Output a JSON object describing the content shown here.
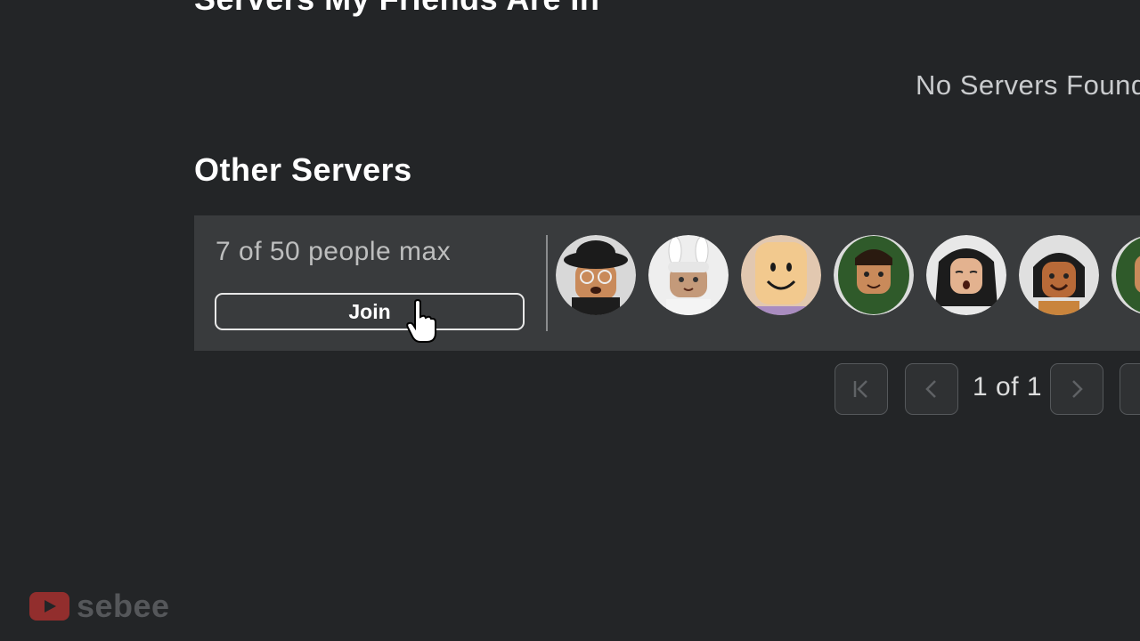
{
  "sections": {
    "friends_title": "Servers My Friends Are In",
    "no_servers": "No Servers Found",
    "other_title": "Other Servers"
  },
  "server": {
    "capacity": "7 of 50 people max",
    "join_label": "Join",
    "players": [
      {
        "name": "player-avatar-1",
        "skin": "#c98a5a",
        "bg": "#d8d8d8"
      },
      {
        "name": "player-avatar-2",
        "skin": "#c49a7a",
        "bg": "#eeeeee"
      },
      {
        "name": "player-avatar-3",
        "skin": "#f2c98e",
        "bg": "#e2c8b0"
      },
      {
        "name": "player-avatar-4",
        "skin": "#c98a5a",
        "bg": "#dcdcdc"
      },
      {
        "name": "player-avatar-5",
        "skin": "#e3b28f",
        "bg": "#e8e8e8"
      },
      {
        "name": "player-avatar-6",
        "skin": "#b86a38",
        "bg": "#e0e0e0"
      },
      {
        "name": "player-avatar-7",
        "skin": "#c98a5a",
        "bg": "#dcdcdc"
      }
    ]
  },
  "pagination": {
    "page_text": "1 of 1"
  },
  "watermark": {
    "channel": "sebee"
  },
  "colors": {
    "background": "#232527",
    "card": "#393b3d",
    "accent_white": "#ffffff"
  }
}
